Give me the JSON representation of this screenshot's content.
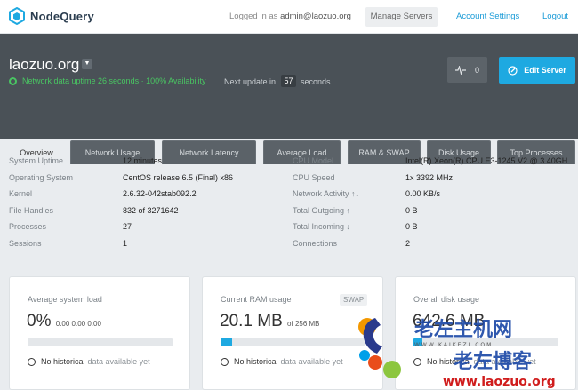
{
  "nav": {
    "brand": "NodeQuery",
    "logged_in_prefix": "Logged in as",
    "email": "admin@laozuo.org",
    "manage_servers": "Manage Servers",
    "account_settings": "Account Settings",
    "logout": "Logout"
  },
  "server": {
    "name": "laozuo.org",
    "uptime_status": "Network data uptime 26 seconds · 100% Availability",
    "next_update_label": "Next update in",
    "next_update_value": "57",
    "next_update_unit": "seconds",
    "alerts_count": "0",
    "edit_button": "Edit Server"
  },
  "tabs": [
    {
      "label": "Overview"
    },
    {
      "label": "Network Usage"
    },
    {
      "label": "Network Latency"
    },
    {
      "label": "Average Load"
    },
    {
      "label": "RAM & SWAP"
    },
    {
      "label": "Disk Usage"
    },
    {
      "label": "Top Processes"
    }
  ],
  "info_left": [
    {
      "label": "System Uptime",
      "value": "12 minutes"
    },
    {
      "label": "Operating System",
      "value": "CentOS release 6.5 (Final) x86"
    },
    {
      "label": "Kernel",
      "value": "2.6.32-042stab092.2"
    },
    {
      "label": "File Handles",
      "value": "832 of 3271642"
    },
    {
      "label": "Processes",
      "value": "27"
    },
    {
      "label": "Sessions",
      "value": "1"
    }
  ],
  "info_right": [
    {
      "label": "CPU Model",
      "value": "Intel(R) Xeon(R) CPU E3-1245 V2 @ 3.40GH..."
    },
    {
      "label": "CPU Speed",
      "value": "1x 3392 MHz"
    },
    {
      "label": "Network Activity ↑↓",
      "value": "0.00 KB/s"
    },
    {
      "label": "Total Outgoing ↑",
      "value": "0 B"
    },
    {
      "label": "Total Incoming ↓",
      "value": "0 B"
    },
    {
      "label": "Connections",
      "value": "2"
    }
  ],
  "cards": {
    "load": {
      "title": "Average system load",
      "big": "0%",
      "sub": "0.00 0.00 0.00",
      "note_strong": "No historical",
      "note_light": "data available yet",
      "fill": 0
    },
    "ram": {
      "title": "Current RAM usage",
      "badge": "SWAP",
      "big": "20.1 MB",
      "sub": "of 256 MB",
      "note_strong": "No historical",
      "note_light": "data available yet",
      "fill": 0.08
    },
    "disk": {
      "title": "Overall disk usage",
      "big": "642.6 MB",
      "note_strong": "No historical",
      "note_light": "data available yet",
      "fill": 0.06
    }
  },
  "watermark": {
    "line1": "老左主机网",
    "line2": "老左博客",
    "url": "www.laozuo.org",
    "tiny": "WWW.KAIKEZI.COM"
  },
  "colors": {
    "accent": "#1ea9e1",
    "success": "#49c562",
    "header_bg": "#4a5157"
  }
}
